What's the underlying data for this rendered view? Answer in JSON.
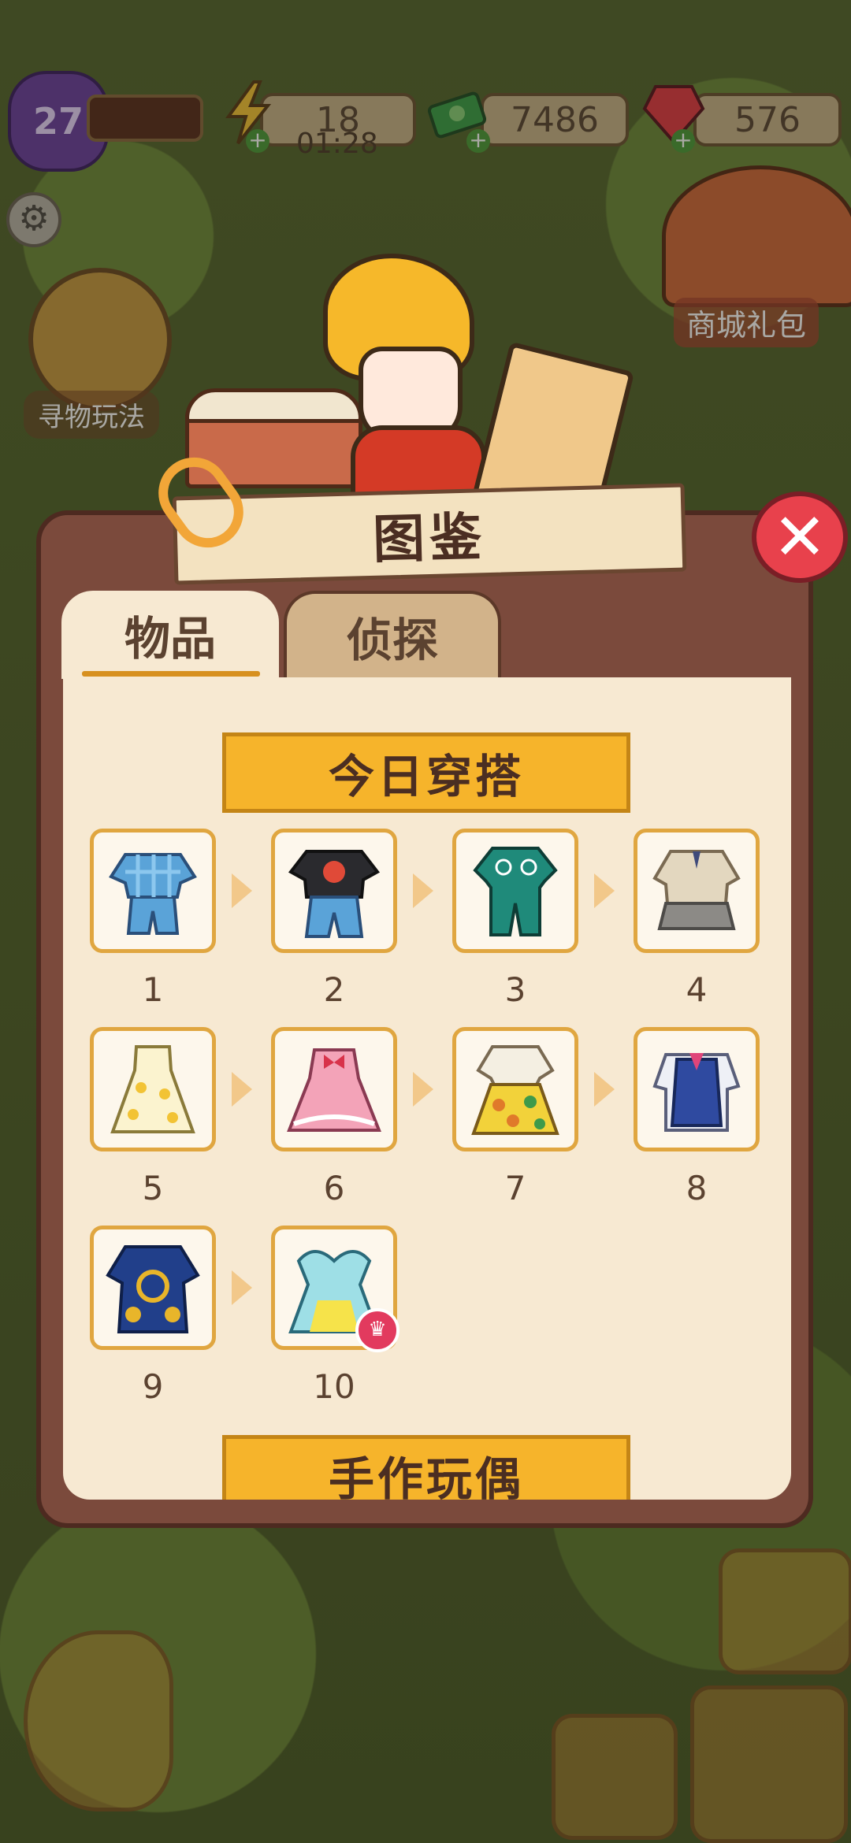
{
  "hud": {
    "level": "27",
    "energy": "18",
    "energy_timer": "01:28",
    "cash": "7486",
    "gems": "576"
  },
  "sidebar": {
    "find_play_label": "寻物玩法",
    "shop_package_label": "商城礼包"
  },
  "dialog": {
    "title": "图鉴",
    "close_icon": "close-icon",
    "tabs": [
      {
        "label": "物品",
        "active": true
      },
      {
        "label": "侦探",
        "active": false
      }
    ],
    "sections": [
      {
        "title": "今日穿搭",
        "items": [
          {
            "number": "1",
            "icon": "blue-plaid-pajamas-icon"
          },
          {
            "number": "2",
            "icon": "black-tshirt-jeans-icon"
          },
          {
            "number": "3",
            "icon": "green-tracksuit-icon"
          },
          {
            "number": "4",
            "icon": "beige-school-uniform-icon"
          },
          {
            "number": "5",
            "icon": "pineapple-dress-icon"
          },
          {
            "number": "6",
            "icon": "pink-lolita-dress-icon"
          },
          {
            "number": "7",
            "icon": "floral-skirt-outfit-icon"
          },
          {
            "number": "8",
            "icon": "blue-vest-uniform-icon"
          },
          {
            "number": "9",
            "icon": "blue-yellow-ethnic-robe-icon"
          },
          {
            "number": "10",
            "icon": "teal-princess-gown-icon",
            "badge": "crown-icon"
          }
        ]
      },
      {
        "title": "手作玩偶"
      }
    ]
  }
}
